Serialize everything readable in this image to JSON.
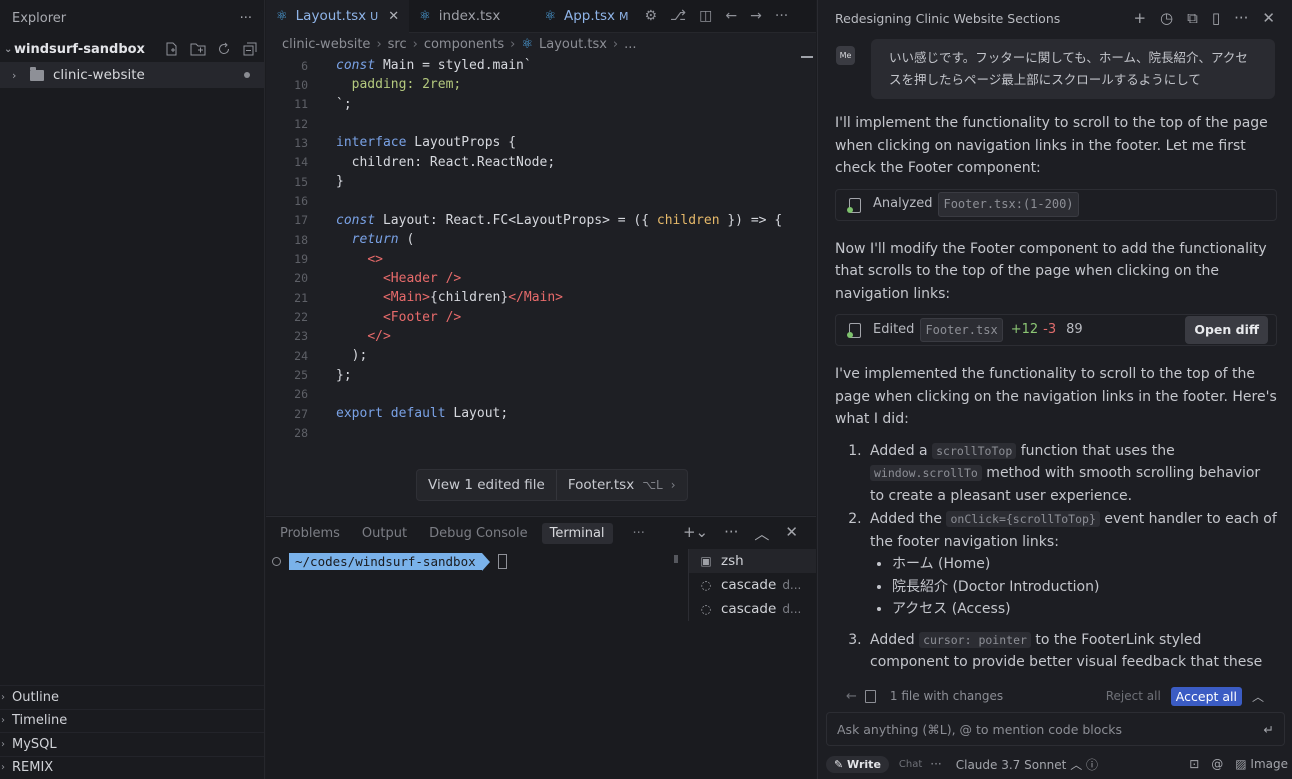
{
  "explorer": {
    "title": "Explorer",
    "more": "···",
    "root": "windsurf-sandbox",
    "folder": "clinic-website",
    "sections": [
      "Outline",
      "Timeline",
      "MySQL",
      "REMIX"
    ]
  },
  "editor": {
    "tabs": [
      {
        "label": "Layout.tsx",
        "mark": "U",
        "active": true
      },
      {
        "label": "index.tsx",
        "mark": "",
        "active": false
      },
      {
        "label": "App.tsx",
        "mark": "M",
        "active": false
      }
    ],
    "breadcrumb": [
      "clinic-website",
      "src",
      "components",
      "Layout.tsx",
      "..."
    ],
    "lines": [
      {
        "n": "6",
        "code": "<span class=\"kw\">const</span> Main = styled.main`"
      },
      {
        "n": "10",
        "code": "  <span class=\"str\">padding: 2rem;</span>"
      },
      {
        "n": "11",
        "code": "`;"
      },
      {
        "n": "12",
        "code": ""
      },
      {
        "n": "13",
        "code": "<span class=\"kwn\">interface</span> LayoutProps {"
      },
      {
        "n": "14",
        "code": "  children: React.ReactNode;"
      },
      {
        "n": "15",
        "code": "}"
      },
      {
        "n": "16",
        "code": ""
      },
      {
        "n": "17",
        "code": "<span class=\"kw\">const</span> Layout: React.FC&lt;LayoutProps&gt; = ({ <span class=\"param\">children</span> }) =&gt; {"
      },
      {
        "n": "18",
        "code": "  <span class=\"kw\">return</span> ("
      },
      {
        "n": "19",
        "code": "    <span class=\"jsx\">&lt;&gt;</span>"
      },
      {
        "n": "20",
        "code": "      <span class=\"jsx\">&lt;Header /&gt;</span>"
      },
      {
        "n": "21",
        "code": "      <span class=\"jsx\">&lt;Main&gt;</span>{children}<span class=\"jsx\">&lt;/Main&gt;</span>"
      },
      {
        "n": "22",
        "code": "      <span class=\"jsx\">&lt;Footer /&gt;</span>"
      },
      {
        "n": "23",
        "code": "    <span class=\"jsx\">&lt;/&gt;</span>"
      },
      {
        "n": "24",
        "code": "  );"
      },
      {
        "n": "25",
        "code": "};"
      },
      {
        "n": "26",
        "code": ""
      },
      {
        "n": "27",
        "code": "<span class=\"kwn\">export default</span> Layout;"
      },
      {
        "n": "28",
        "code": ""
      }
    ],
    "edited_bar": {
      "view": "View 1 edited file",
      "file": "Footer.tsx",
      "shortcut": "⌥L"
    }
  },
  "panel": {
    "tabs": [
      "Problems",
      "Output",
      "Debug Console",
      "Terminal"
    ],
    "active_tab": "Terminal",
    "prompt_path": "~/codes/windsurf-sandbox",
    "terminals": [
      {
        "name": "zsh",
        "sub": ""
      },
      {
        "name": "cascade",
        "sub": "d..."
      },
      {
        "name": "cascade",
        "sub": "d..."
      }
    ]
  },
  "chat": {
    "title": "Redesigning Clinic Website Sections",
    "user_badge": "Me",
    "user_message": "いい感じです。フッターに関しても、ホーム、院長紹介、アクセスを押したらページ最上部にスクロールするようにして",
    "p1": "I'll implement the functionality to scroll to the top of the page when clicking on navigation links in the footer. Let me first check the Footer component:",
    "analyzed": {
      "label": "Analyzed",
      "file": "Footer.tsx:(1-200)"
    },
    "p2": "Now I'll modify the Footer component to add the functionality that scrolls to the top of the page when clicking on the navigation links:",
    "edited": {
      "label": "Edited",
      "file": "Footer.tsx",
      "plus": "+12",
      "minus": "-3",
      "count": "89",
      "open_diff": "Open diff"
    },
    "p3": "I've implemented the functionality to scroll to the top of the page when clicking on the navigation links in the footer. Here's what I did:",
    "step1": {
      "a": "Added a ",
      "code1": "scrollToTop",
      "b": " function that uses the ",
      "code2": "window.scrollTo",
      "c": " method with smooth scrolling behavior to create a pleasant user experience."
    },
    "step2": {
      "a": "Added the ",
      "code": "onClick={scrollToTop}",
      "b": " event handler to each of the footer navigation links:"
    },
    "links": [
      "ホーム (Home)",
      "院長紹介 (Doctor Introduction)",
      "アクセス (Access)"
    ],
    "step3": {
      "a": "Added ",
      "code": "cursor: pointer",
      "b": " to the FooterLink styled component to provide better visual feedback that these"
    },
    "changes": {
      "label": "1 file with changes",
      "reject": "Reject all",
      "accept": "Accept all"
    },
    "input_placeholder": "Ask anything (⌘L), @ to mention code blocks",
    "footer": {
      "write": "Write",
      "chat": "Chat",
      "model": "Claude 3.7 Sonnet",
      "image": "Image"
    }
  }
}
